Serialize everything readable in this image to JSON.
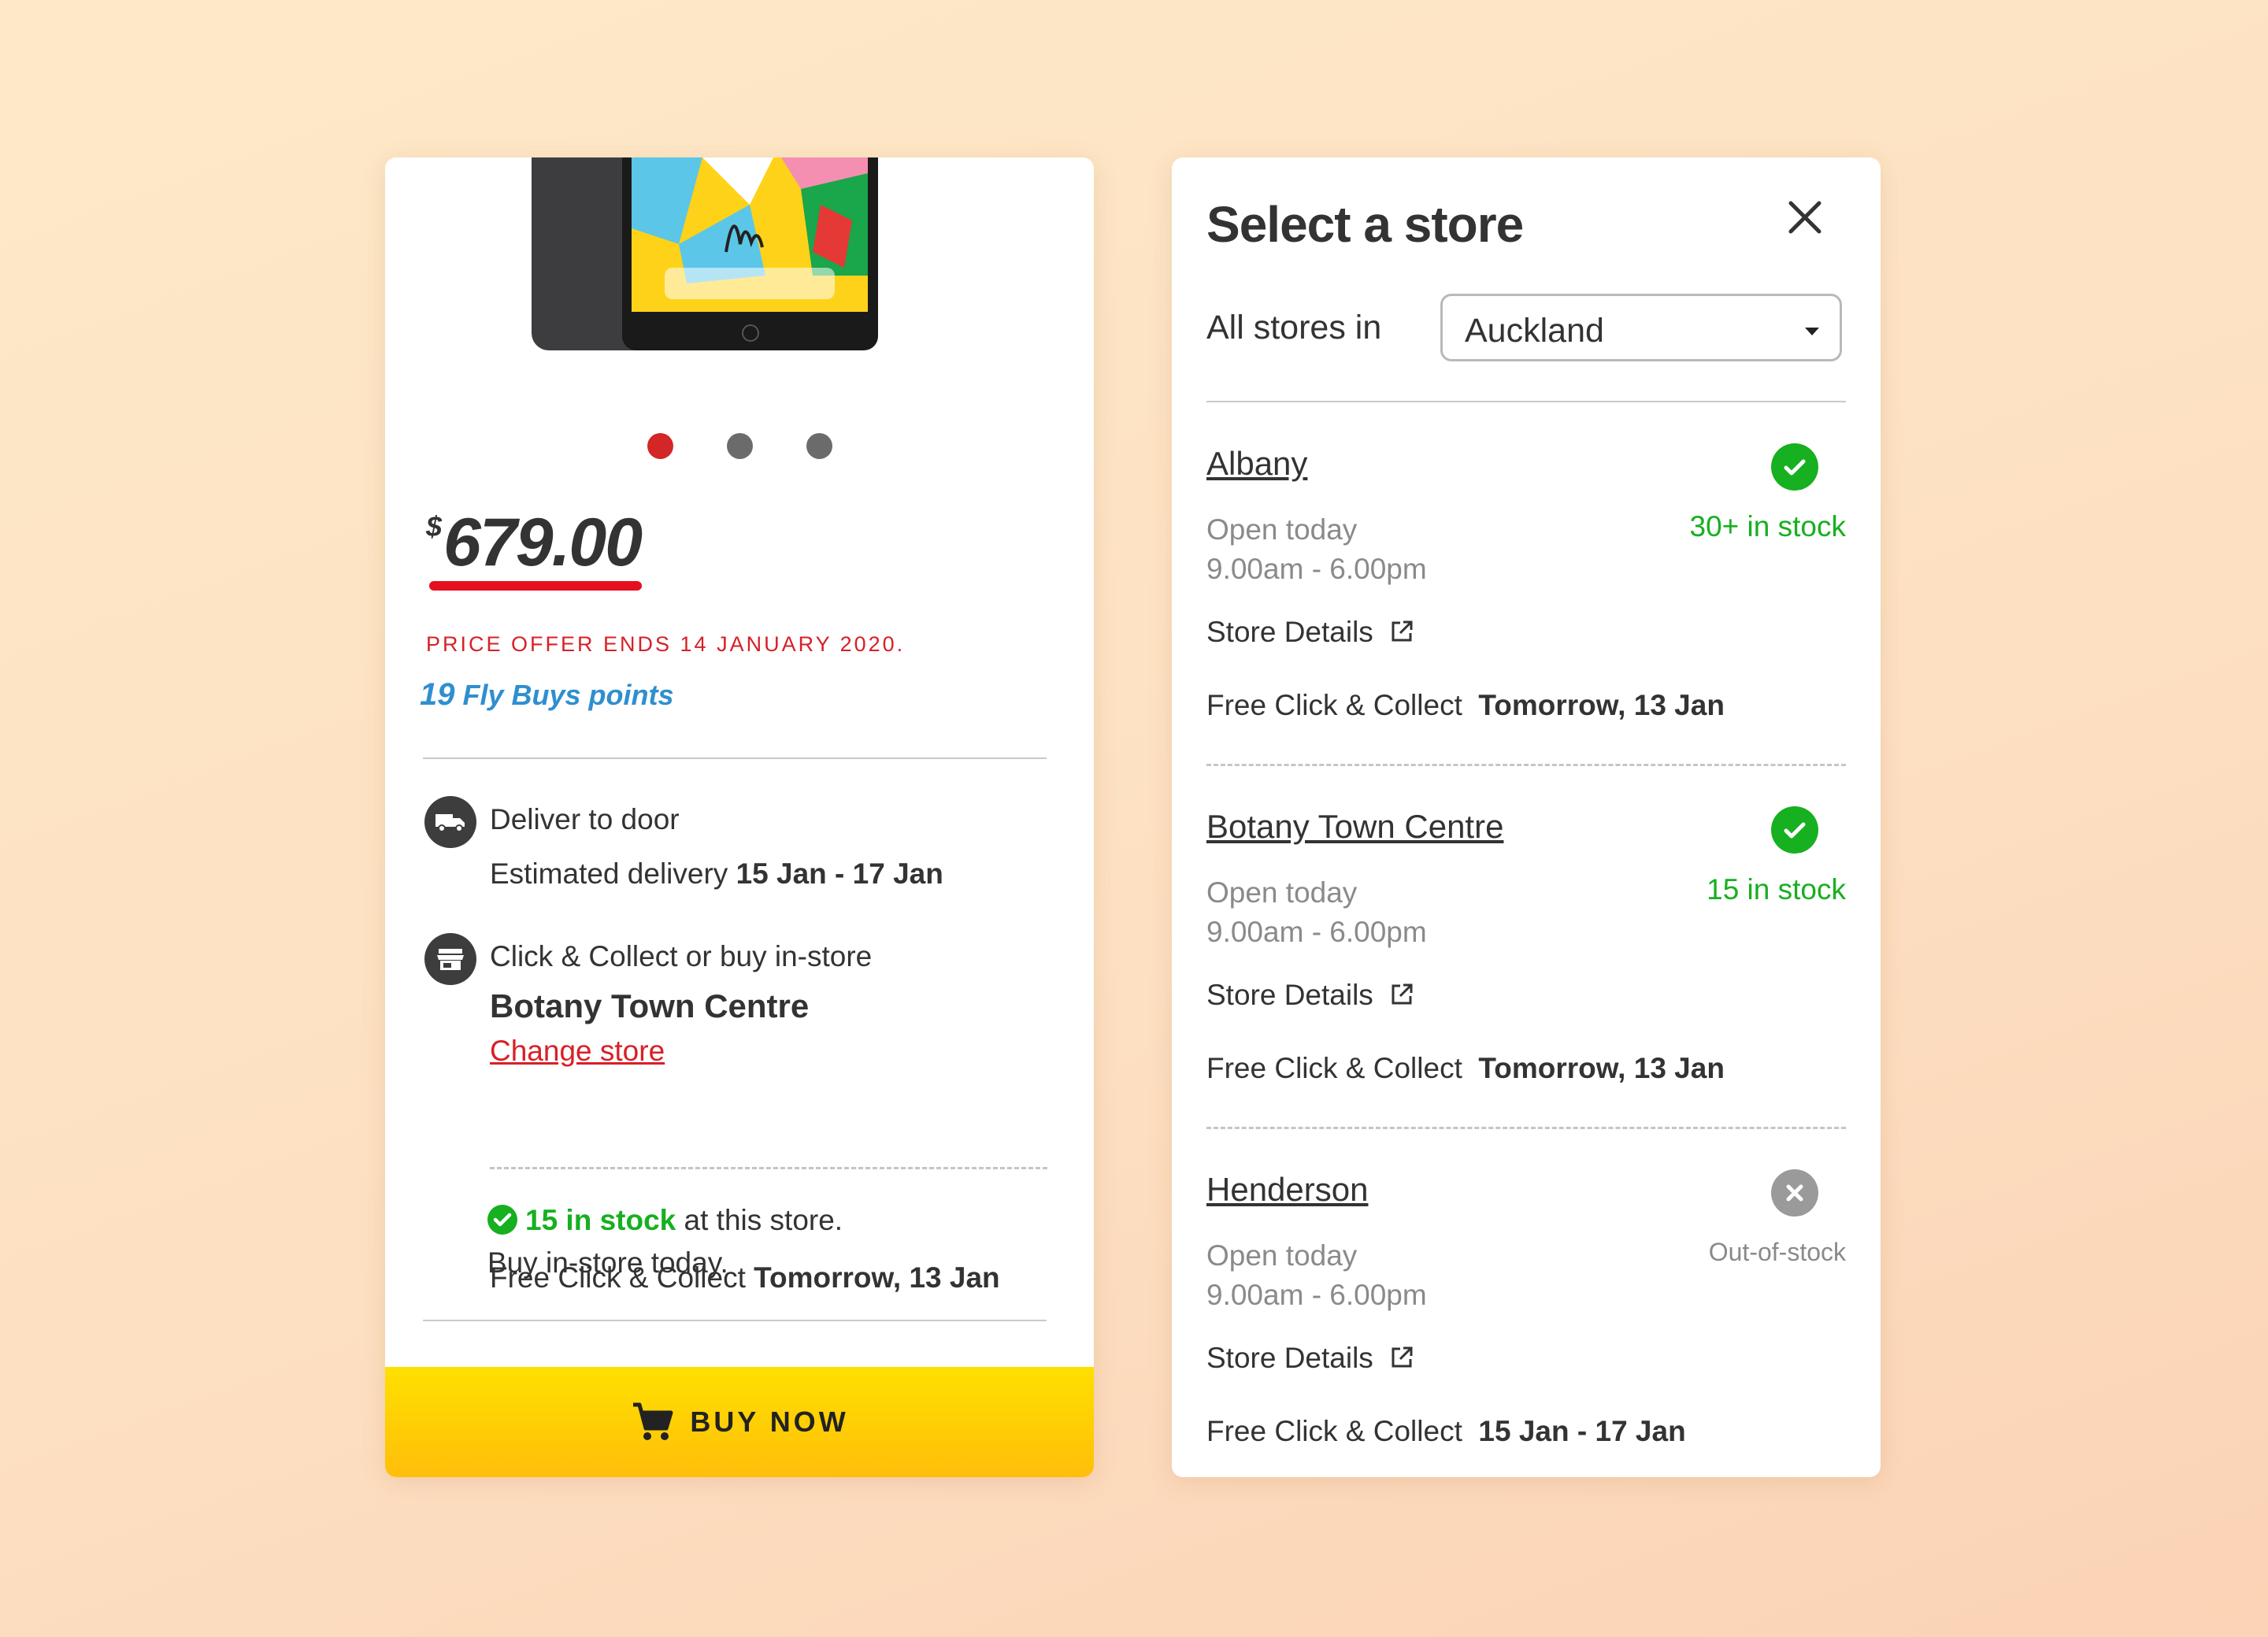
{
  "product": {
    "price_symbol": "$",
    "price": "679.00",
    "offer": "PRICE OFFER ENDS 14 JANUARY 2020.",
    "flybuys_count": "19",
    "flybuys_label": "Fly Buys points",
    "carousel": {
      "total": 3,
      "active": 1
    },
    "delivery": {
      "title": "Deliver to door",
      "estimate_prefix": "Estimated delivery",
      "estimate_dates": "15 Jan - 17 Jan"
    },
    "collect": {
      "title": "Click & Collect or buy in-store",
      "store": "Botany Town Centre",
      "change_link": "Change store",
      "free_prefix": "Free Click & Collect",
      "free_date": "Tomorrow, 13 Jan",
      "stock_count": "15 in stock",
      "stock_suffix": "at this store.",
      "buy_today": "Buy in-store today."
    },
    "buy_button": "BUY NOW"
  },
  "store_panel": {
    "title": "Select a store",
    "filter_label": "All stores in",
    "city": "Auckland",
    "stores": [
      {
        "name": "Albany",
        "open": "Open today",
        "hours": "9.00am - 6.00pm",
        "details": "Store Details",
        "stock": "30+  in stock",
        "in_stock": true,
        "collect_prefix": "Free Click & Collect",
        "collect_date": "Tomorrow, 13 Jan"
      },
      {
        "name": "Botany Town Centre",
        "open": "Open today",
        "hours": "9.00am - 6.00pm",
        "details": "Store Details",
        "stock": "15  in stock",
        "in_stock": true,
        "collect_prefix": "Free Click & Collect",
        "collect_date": "Tomorrow, 13 Jan"
      },
      {
        "name": "Henderson",
        "open": "Open today",
        "hours": "9.00am - 6.00pm",
        "details": "Store Details",
        "stock": "Out-of-stock",
        "in_stock": false,
        "collect_prefix": "Free Click & Collect",
        "collect_date": "15 Jan - 17 Jan"
      }
    ]
  },
  "colors": {
    "accent_red": "#d72027",
    "stock_green": "#16b020",
    "button_yellow": "#ffd000"
  }
}
